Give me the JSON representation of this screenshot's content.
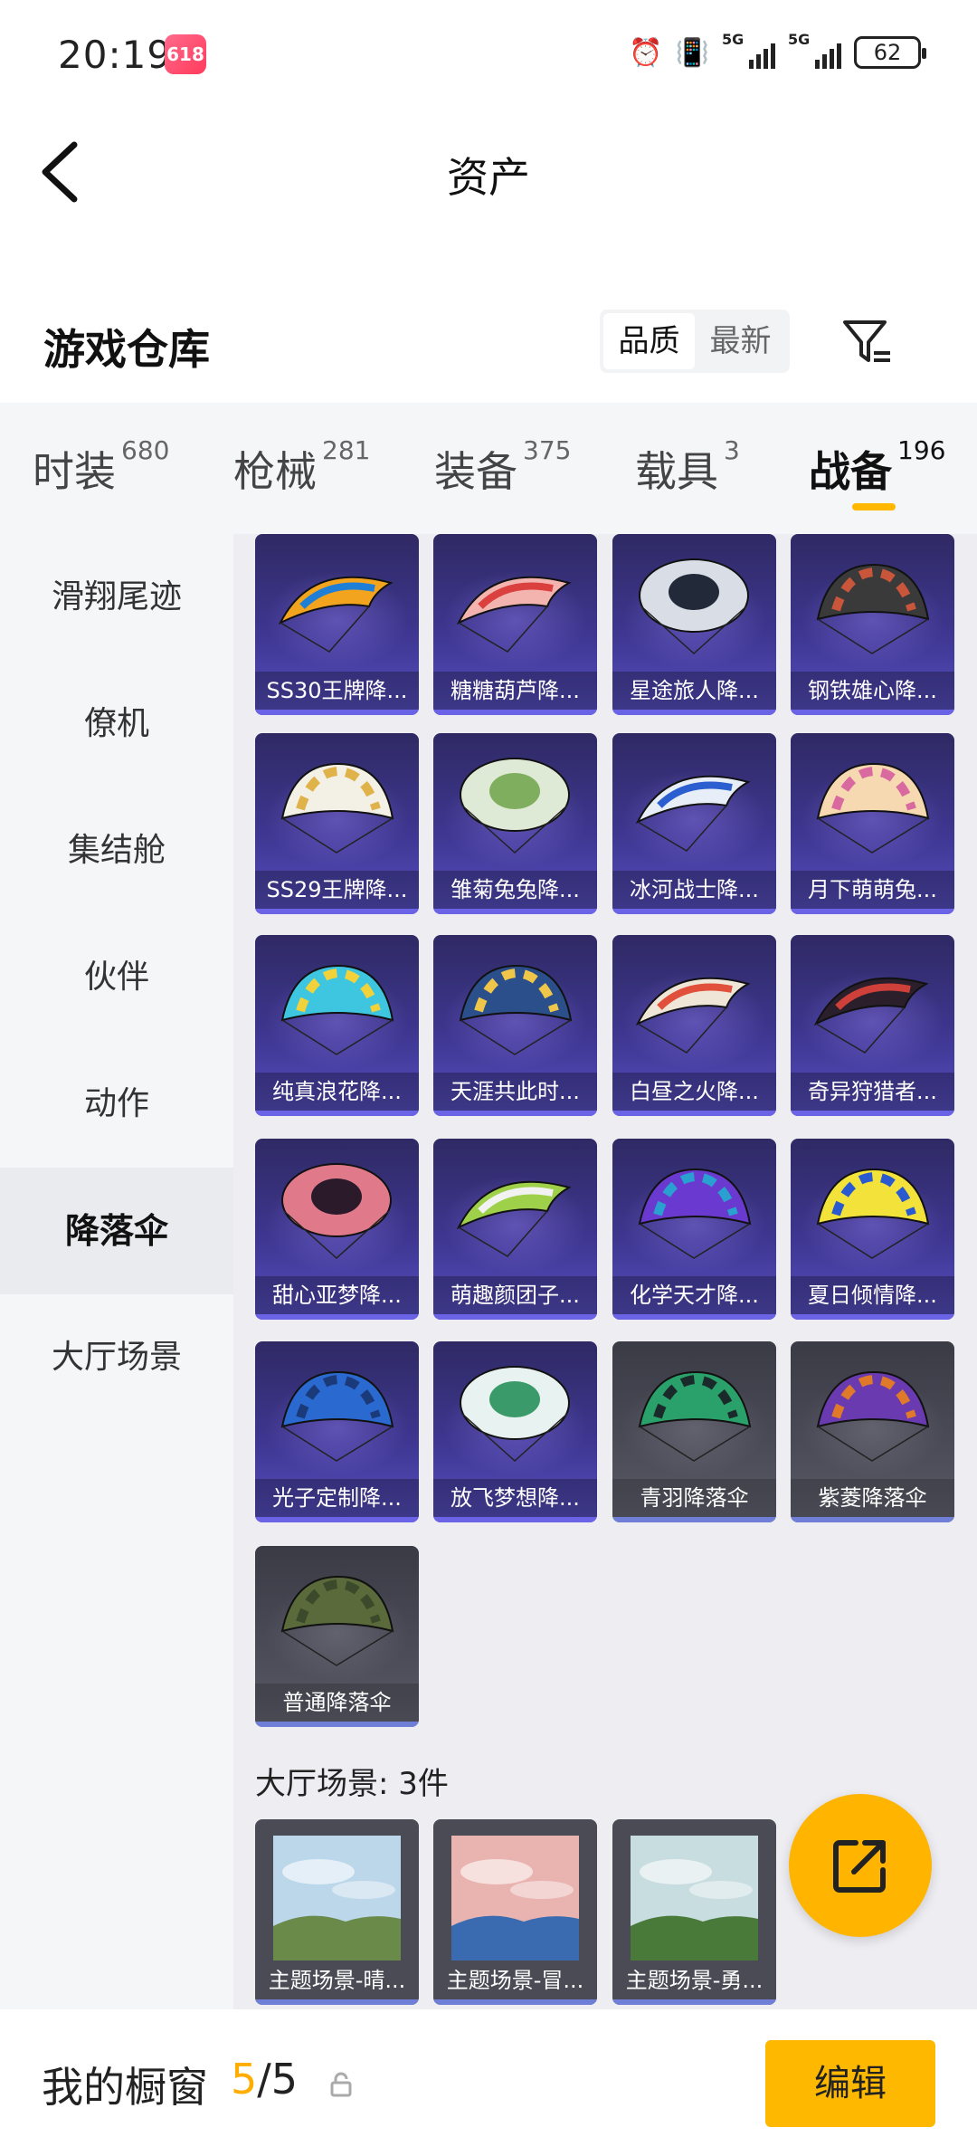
{
  "status_bar": {
    "time": "20:19",
    "app_badge": "618",
    "net1": "5G",
    "net2": "5G",
    "battery": "62"
  },
  "nav": {
    "title": "资产"
  },
  "warehouse": {
    "title": "游戏仓库",
    "sort_options": [
      "品质",
      "最新"
    ],
    "active_sort": "品质"
  },
  "category_tabs": [
    {
      "label": "时装",
      "count": "680"
    },
    {
      "label": "枪械",
      "count": "281"
    },
    {
      "label": "装备",
      "count": "375"
    },
    {
      "label": "载具",
      "count": "3"
    },
    {
      "label": "战备",
      "count": "196"
    }
  ],
  "active_tab": "战备",
  "sidebar": {
    "items": [
      "滑翔尾迹",
      "僚机",
      "集结舱",
      "伙伴",
      "动作",
      "降落伞",
      "大厅场景"
    ],
    "active": "降落伞"
  },
  "parachutes": [
    {
      "name": "SS30王牌降...",
      "colors": [
        "#f2a41e",
        "#1f7fd6"
      ],
      "style": "wing"
    },
    {
      "name": "糖糖葫芦降...",
      "colors": [
        "#f3b4b0",
        "#d9403e"
      ],
      "style": "wing"
    },
    {
      "name": "星途旅人降...",
      "colors": [
        "#d8dde6",
        "#222a3a"
      ],
      "style": "round"
    },
    {
      "name": "钢铁雄心降...",
      "colors": [
        "#3a3a3a",
        "#c9553a"
      ],
      "style": "dome"
    },
    {
      "name": "SS29王牌降...",
      "colors": [
        "#f3f0e6",
        "#e0b24a"
      ],
      "style": "dome"
    },
    {
      "name": "雏菊兔兔降...",
      "colors": [
        "#dfead6",
        "#7fae5e"
      ],
      "style": "round"
    },
    {
      "name": "冰河战士降...",
      "colors": [
        "#e8eef8",
        "#2b5fd0"
      ],
      "style": "wing"
    },
    {
      "name": "月下萌萌兔...",
      "colors": [
        "#f6d9b0",
        "#d96aa0"
      ],
      "style": "dome"
    },
    {
      "name": "纯真浪花降...",
      "colors": [
        "#3ec6e0",
        "#f2d23a"
      ],
      "style": "dome"
    },
    {
      "name": "天涯共此时...",
      "colors": [
        "#2a4f8a",
        "#f0c64a"
      ],
      "style": "dome"
    },
    {
      "name": "白昼之火降...",
      "colors": [
        "#efe6d8",
        "#e0503a"
      ],
      "style": "wing"
    },
    {
      "name": "奇异狩猎者...",
      "colors": [
        "#2a1f2a",
        "#d0403a"
      ],
      "style": "wing"
    },
    {
      "name": "甜心亚梦降...",
      "colors": [
        "#e07a8a",
        "#2a1a2a"
      ],
      "style": "round"
    },
    {
      "name": "萌趣颜团子...",
      "colors": [
        "#9ed04a",
        "#f2f2f2"
      ],
      "style": "wing"
    },
    {
      "name": "化学天才降...",
      "colors": [
        "#6a3ad0",
        "#2aa0d0"
      ],
      "style": "dome"
    },
    {
      "name": "夏日倾情降...",
      "colors": [
        "#f2e23a",
        "#2a5ad0"
      ],
      "style": "dome"
    },
    {
      "name": "光子定制降...",
      "colors": [
        "#2a6ad0",
        "#1a3a7a"
      ],
      "style": "dome"
    },
    {
      "name": "放飞梦想降...",
      "colors": [
        "#e8f2f0",
        "#3a9a6a"
      ],
      "style": "round"
    },
    {
      "name": "青羽降落伞",
      "colors": [
        "#2aa06a",
        "#1a2a2a"
      ],
      "style": "dome",
      "tier": "grey"
    },
    {
      "name": "紫菱降落伞",
      "colors": [
        "#6a3ab0",
        "#e07a2a"
      ],
      "style": "dome",
      "tier": "grey"
    },
    {
      "name": "普通降落伞",
      "colors": [
        "#5a6a3a",
        "#3a4a2a"
      ],
      "style": "dome",
      "tier": "grey"
    }
  ],
  "scenes_section": {
    "title": "大厅场景: 3件"
  },
  "scenes": [
    {
      "name": "主题场景-晴...",
      "sky": "#bcd6ea",
      "ground": "#6a8a4a"
    },
    {
      "name": "主题场景-冒...",
      "sky": "#e9b4b0",
      "ground": "#3a6ab0"
    },
    {
      "name": "主题场景-勇...",
      "sky": "#c8dde0",
      "ground": "#4a7a3a"
    }
  ],
  "bottom_bar": {
    "label": "我的橱窗",
    "count_current": "5",
    "count_total": "/5",
    "edit_label": "编辑"
  },
  "colors": {
    "accent": "#ffb800",
    "card_purple": "#3e3690",
    "card_grey": "#4b4c58"
  }
}
